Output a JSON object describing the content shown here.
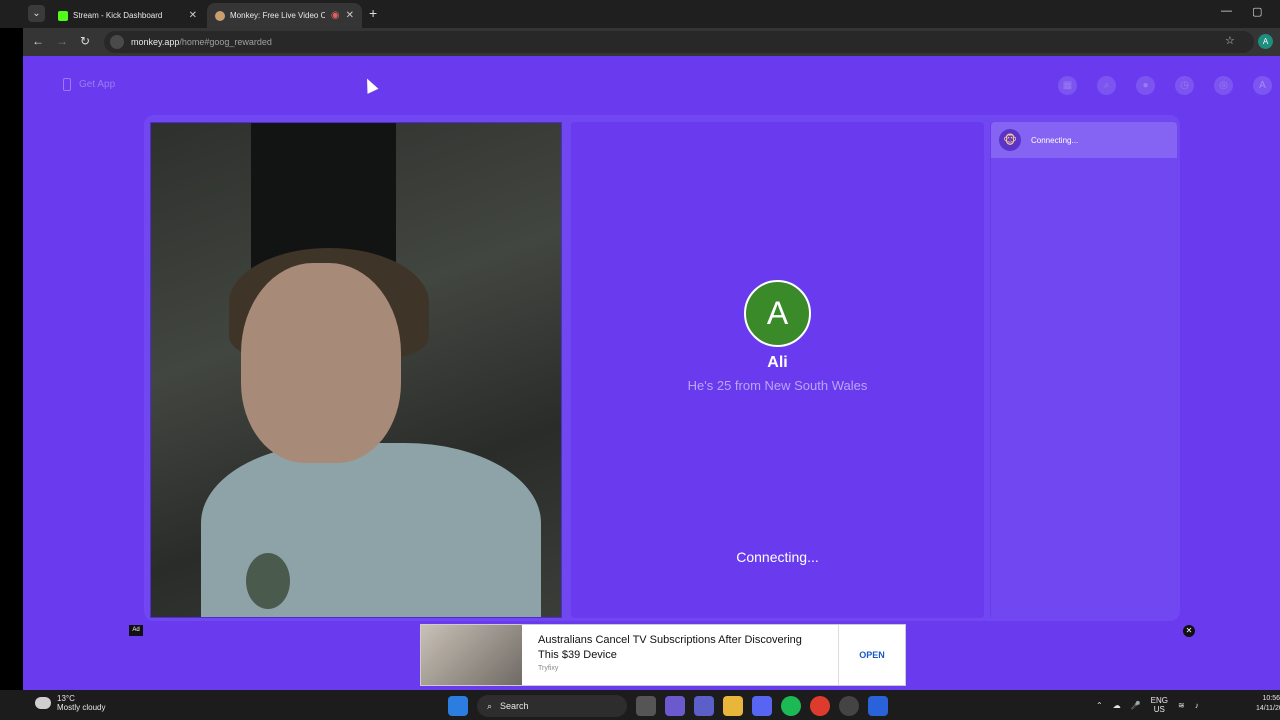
{
  "browser": {
    "tabs": [
      {
        "title": "Stream - Kick Dashboard",
        "favicon": "kick-icon",
        "active": false
      },
      {
        "title": "Monkey: Free Live Video Ch",
        "favicon": "monkey-icon",
        "active": true
      }
    ],
    "url_host": "monkey.app",
    "url_path": "/home#goog_rewarded",
    "profile_initial": "A"
  },
  "page": {
    "get_app_label": "Get App",
    "top_icons": [
      "store-icon",
      "search-icon",
      "globe-avatar-icon",
      "history-icon",
      "chat-icon"
    ],
    "user_initial": "A"
  },
  "peer": {
    "initial": "A",
    "name": "Ali",
    "subtitle": "He's 25 from New South Wales",
    "status": "Connecting..."
  },
  "chat": {
    "status": "Connecting..."
  },
  "ad": {
    "tag": "Ad",
    "title": "Australians Cancel TV Subscriptions After Discovering This $39 Device",
    "source": "Tryfixy",
    "cta": "OPEN"
  },
  "taskbar": {
    "temperature": "13°C",
    "weather": "Mostly cloudy",
    "search_label": "Search",
    "lang_line1": "ENG",
    "lang_line2": "US",
    "time": "10:56",
    "date": "14/11/20"
  },
  "colors": {
    "page_bg": "#6a3bee",
    "peer_avatar": "#3b8a2a",
    "ad_cta": "#1a58c9"
  }
}
